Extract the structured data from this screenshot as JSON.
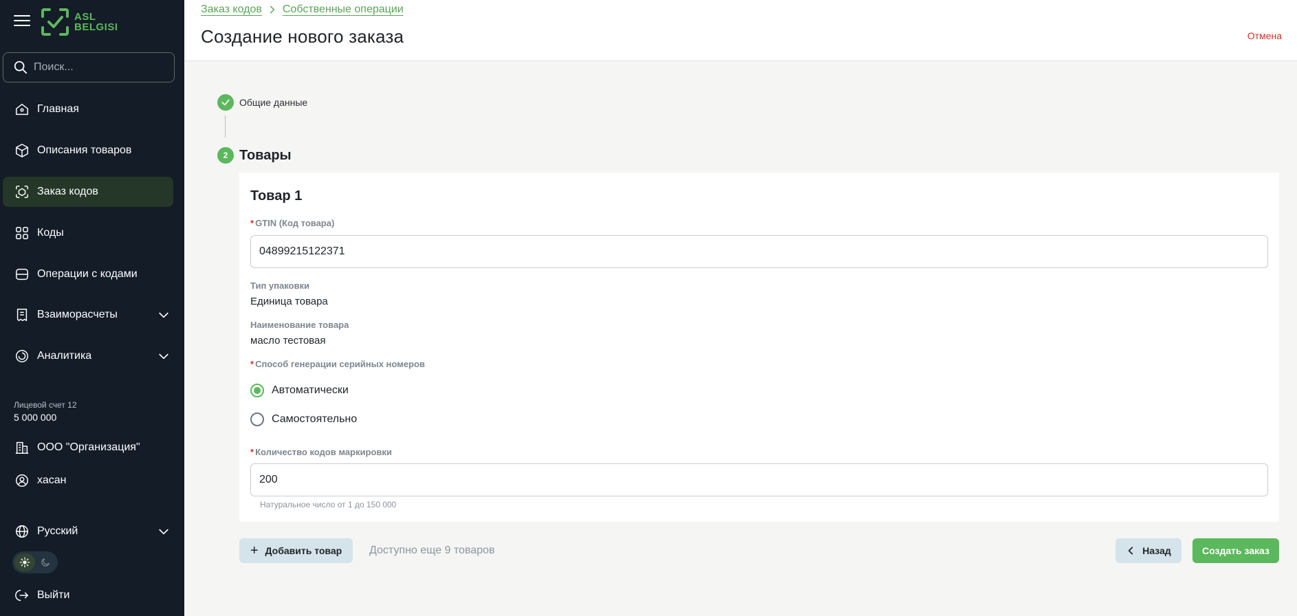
{
  "sidebar": {
    "logo_line1": "ASL",
    "logo_line2": "BELGISI",
    "search_placeholder": "Поиск...",
    "items": [
      {
        "label": "Главная",
        "icon": "home-icon"
      },
      {
        "label": "Описания товаров",
        "icon": "box-icon"
      },
      {
        "label": "Заказ кодов",
        "icon": "code-order-icon",
        "active": true
      },
      {
        "label": "Коды",
        "icon": "qr-codes-icon"
      },
      {
        "label": "Операции с кодами",
        "icon": "code-operations-icon"
      },
      {
        "label": "Взаиморасчеты",
        "icon": "receipt-icon",
        "expandable": true
      },
      {
        "label": "Аналитика",
        "icon": "analytics-icon",
        "expandable": true
      }
    ],
    "account_label": "Лицевой счет 12",
    "account_value": "5 000 000",
    "organization": "ООО \"Организация\"",
    "user": "хасан",
    "language": "Русский",
    "logout": "Выйти"
  },
  "header": {
    "breadcrumbs": [
      "Заказ кодов",
      "Собственные операции"
    ],
    "title": "Создание нового заказа",
    "cancel_label": "Отмена"
  },
  "stepper": {
    "step1_label": "Общие данные",
    "step2_number": "2",
    "step2_label": "Товары"
  },
  "product": {
    "title": "Товар 1",
    "gtin_label": "GTIN (Код товара)",
    "gtin_value": "04899215122371",
    "pack_type_label": "Тип упаковки",
    "pack_type_value": "Единица товара",
    "name_label": "Наименование товара",
    "name_value": "масло тестовая",
    "serial_method_label": "Способ генерации серийных номеров",
    "serial_options": [
      "Автоматически",
      "Самостоятельно"
    ],
    "serial_selected": "Автоматически",
    "quantity_label": "Количество кодов маркировки",
    "quantity_value": "200",
    "quantity_hint": "Натуральное число от 1 до 150 000"
  },
  "actions": {
    "add_label": "Добавить товар",
    "available_text": "Доступно еще 9 товаров",
    "back_label": "Назад",
    "create_label": "Создать заказ"
  },
  "colors": {
    "accent": "#5cb85c",
    "sidebar_bg": "#131c27",
    "danger": "#d0312d"
  }
}
